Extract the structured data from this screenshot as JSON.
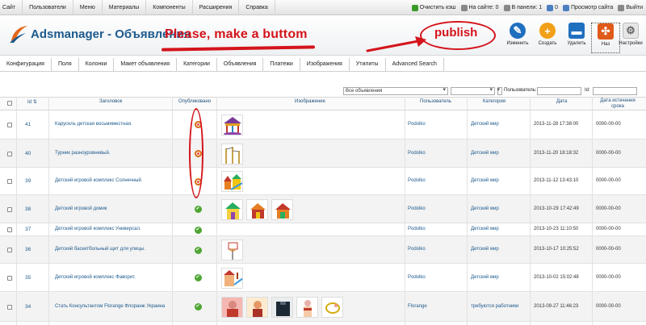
{
  "topbar": {
    "menu": [
      "Сайт",
      "Пользователи",
      "Меню",
      "Материалы",
      "Компоненты",
      "Расширения",
      "Справка"
    ],
    "status": [
      {
        "label": "Очистить кэш",
        "icon": "clear-cache-icon",
        "color": "#3a9b2a"
      },
      {
        "label": "На сайте: 0",
        "icon": "users-online-icon",
        "color": "#888888"
      },
      {
        "label": "В панели: 1",
        "icon": "admin-panel-icon",
        "color": "#888888"
      },
      {
        "label": "0",
        "icon": "messages-icon",
        "color": "#4c7fc1"
      },
      {
        "label": "Просмотр сайта",
        "icon": "view-site-icon",
        "color": "#4c7fc1"
      },
      {
        "label": "Выйти",
        "icon": "logout-icon",
        "color": "#888888"
      }
    ]
  },
  "header": {
    "title": "Adsmanager - Объявления",
    "annotation_request": "Please, make a buttom",
    "annotation_publish": "publish"
  },
  "toolbar": {
    "buttons": [
      {
        "label": "Изменить",
        "icon": "edit-icon",
        "color": "#1f6fbf"
      },
      {
        "label": "Создать",
        "icon": "add-icon",
        "color": "#f2a019"
      },
      {
        "label": "Удалить",
        "icon": "delete-icon",
        "color": "#1f6fbf"
      },
      {
        "label": "Наз",
        "icon": "move-icon",
        "color": "#e05a1a"
      },
      {
        "label": "Настройки",
        "icon": "settings-icon",
        "color": "#8a8a8a"
      }
    ]
  },
  "submenu": [
    "Конфигурация",
    "Поля",
    "Колонки",
    "Макет объявления",
    "Категории",
    "Объявления",
    "Платежи",
    "Изображения",
    "Утилиты",
    "Advanced Search"
  ],
  "filters": {
    "ads_select": "Все объявления",
    "user_label": "Пользователь:",
    "id_label": "Id:"
  },
  "table": {
    "headers": {
      "id": "Id",
      "title": "Заголовок",
      "published": "Опубликовано",
      "images": "Изображение",
      "user": "Пользователь",
      "category": "Категория",
      "date": "Дата",
      "expiry": "Дата истечения срока"
    },
    "rows": [
      {
        "id": "41",
        "title": "Карусель детская восьмиместная.",
        "published": false,
        "images": [
          "carousel"
        ],
        "user": "Podolko",
        "category": "Детский мир",
        "date": "2013-11-28 17:38:00",
        "expiry": "0000-00-00"
      },
      {
        "id": "40",
        "title": "Турник разноуровневый.",
        "published": false,
        "images": [
          "bars"
        ],
        "user": "Podolko",
        "category": "Детский мир",
        "date": "2013-11-20 18:18:32",
        "expiry": "0000-00-00"
      },
      {
        "id": "39",
        "title": "Детский игровой комплекс Солнечный.",
        "published": false,
        "images": [
          "playground"
        ],
        "user": "Podolko",
        "category": "Детский мир",
        "date": "2013-11-12 13:43:10",
        "expiry": "0000-00-00"
      },
      {
        "id": "38",
        "title": "Детский игровой домик",
        "published": true,
        "images": [
          "house1",
          "house2",
          "house3"
        ],
        "user": "Podolko",
        "category": "Детский мир",
        "date": "2013-10-29 17:42:49",
        "expiry": "0000-00-00"
      },
      {
        "id": "37",
        "title": "Детский игровой комплекс Универсал.",
        "published": true,
        "images": [],
        "user": "Podolko",
        "category": "Детский мир",
        "date": "2013-10-23 11:10:50",
        "expiry": "0000-00-00"
      },
      {
        "id": "36",
        "title": "Детский баскетбольный щит для улицы.",
        "published": true,
        "images": [
          "basket"
        ],
        "user": "Podolko",
        "category": "Детский мир",
        "date": "2013-10-17 10:25:52",
        "expiry": "0000-00-00"
      },
      {
        "id": "35",
        "title": "Детский игровой комплекс Фаворит.",
        "published": true,
        "images": [
          "complex"
        ],
        "user": "Podolko",
        "category": "Детский мир",
        "date": "2013-10-02 15:02:48",
        "expiry": "0000-00-00"
      },
      {
        "id": "34",
        "title": "Стать Консультантом Florange Флоранж Украина",
        "published": true,
        "images": [
          "f1",
          "f2",
          "f3",
          "f4",
          "f5"
        ],
        "user": "Florange",
        "category": "требуются работники",
        "date": "2013-09-27 11:46:23",
        "expiry": "0000-00-00"
      }
    ]
  }
}
